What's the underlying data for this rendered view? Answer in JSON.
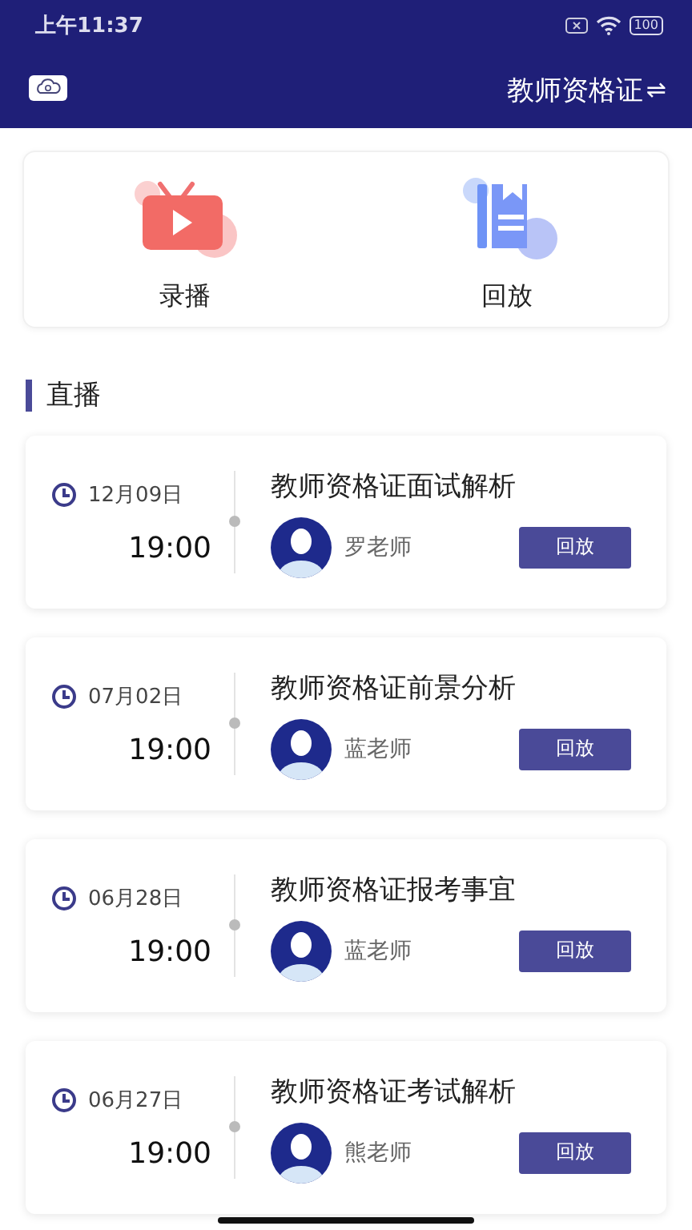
{
  "status_bar": {
    "time": "上午11:37",
    "battery": "100"
  },
  "header": {
    "title": "教师资格证",
    "switch_icon": "⇌"
  },
  "shortcuts": [
    {
      "kind": "tv",
      "label": "录播"
    },
    {
      "kind": "book",
      "label": "回放"
    }
  ],
  "section": {
    "title": "直播"
  },
  "lessons": [
    {
      "date": "12月09日",
      "time": "19:00",
      "title": "教师资格证面试解析",
      "teacher": "罗老师",
      "button": "回放"
    },
    {
      "date": "07月02日",
      "time": "19:00",
      "title": "教师资格证前景分析",
      "teacher": "蓝老师",
      "button": "回放"
    },
    {
      "date": "06月28日",
      "time": "19:00",
      "title": "教师资格证报考事宜",
      "teacher": "蓝老师",
      "button": "回放"
    },
    {
      "date": "06月27日",
      "time": "19:00",
      "title": "教师资格证考试解析",
      "teacher": "熊老师",
      "button": "回放"
    }
  ]
}
